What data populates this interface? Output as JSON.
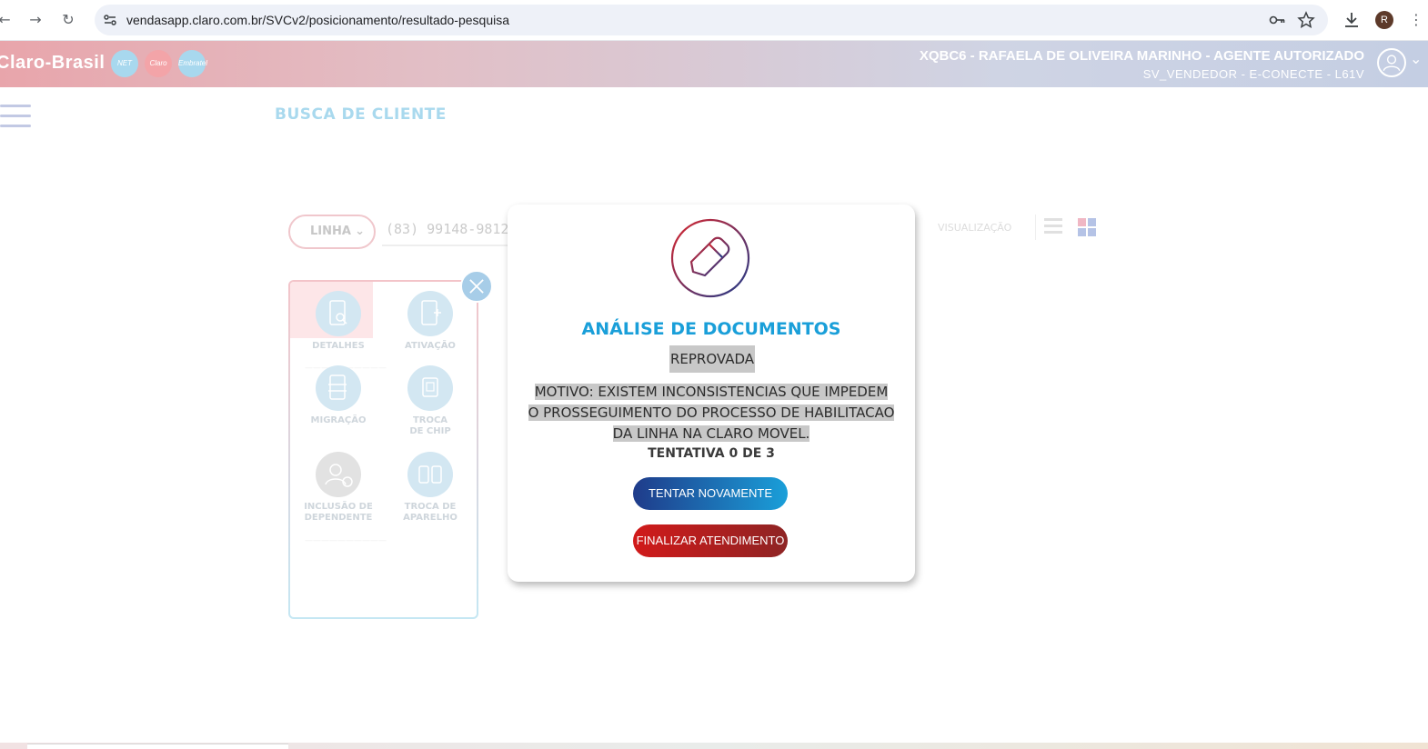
{
  "browser": {
    "url": "vendasapp.claro.com.br/SVCv2/posicionamento/resultado-pesquisa",
    "profile_initial": "R"
  },
  "header": {
    "brand": "Claro-Brasil",
    "brand_badges": [
      "NET",
      "Claro",
      "Embratel"
    ],
    "agent_name": "XQBC6 - RAFAELA DE OLIVEIRA MARINHO - AGENTE AUTORIZADO",
    "agent_sub": "SV_VENDEDOR - E-CONECTE - L61V"
  },
  "page": {
    "title": "BUSCA DE CLIENTE",
    "search_type": "LINHA",
    "search_value": "(83) 99148-9812",
    "visualization_label": "VISUALIZAÇÃO"
  },
  "card": {
    "actions": [
      {
        "label": "DETALHES",
        "icon": "phone-search-icon"
      },
      {
        "label": "ATIVAÇÃO",
        "icon": "phone-add-icon"
      },
      {
        "label": "MIGRAÇÃO",
        "icon": "phone-swap-icon"
      },
      {
        "label": "TROCA\nDE CHIP",
        "icon": "sim-swap-icon"
      },
      {
        "label": "INCLUSÃO DE\nDEPENDENTE",
        "icon": "add-user-icon"
      },
      {
        "label": "TROCA DE\nAPARELHO",
        "icon": "device-swap-icon"
      }
    ]
  },
  "modal": {
    "title": "ANÁLISE DE DOCUMENTOS",
    "status": "REPROVADA",
    "reason": "MOTIVO: EXISTEM INCONSISTENCIAS QUE IMPEDEM O PROSSEGUIMENTO DO PROCESSO DE HABILITACAO DA LINHA NA CLARO MOVEL.",
    "attempt": "TENTATIVA 0 DE 3",
    "retry_button": "TENTAR NOVAMENTE",
    "finish_button": "FINALIZAR ATENDIMENTO"
  },
  "colors": {
    "accent_blue": "#1a9fd9",
    "retry_gradient": [
      "#1f3b8a",
      "#1a9fd9"
    ],
    "finish_gradient": [
      "#d11a1a",
      "#8e2424"
    ]
  }
}
